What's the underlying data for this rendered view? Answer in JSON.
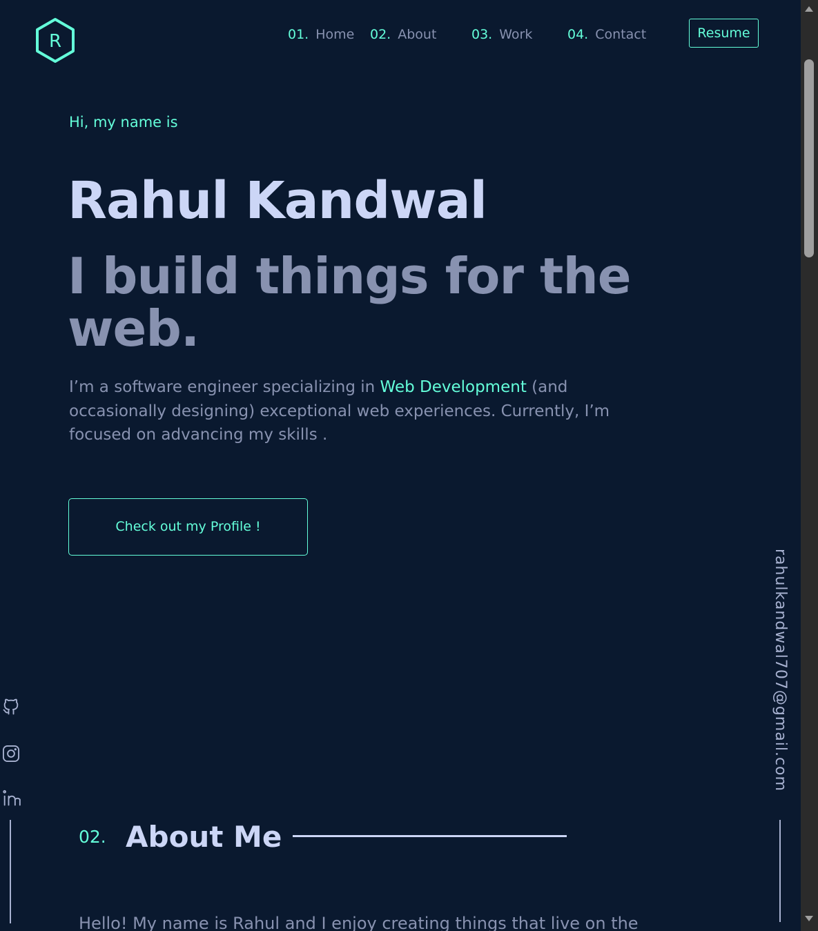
{
  "header": {
    "logo_letter": "R",
    "nav": [
      {
        "num": "01.",
        "label": "Home"
      },
      {
        "num": "02.",
        "label": "About"
      },
      {
        "num": "03.",
        "label": "Work"
      },
      {
        "num": "04.",
        "label": "Contact"
      }
    ],
    "resume_label": "Resume"
  },
  "hero": {
    "greeting": "Hi, my name is",
    "name": "Rahul Kandwal",
    "tagline": "I build things for the web.",
    "intro_before": "I’m a software engineer specializing in ",
    "intro_highlight": "Web Development",
    "intro_after": " (and occasionally designing) exceptional web experiences. Currently, I’m focused on advancing my skills .",
    "cta_label": "Check out my Profile !"
  },
  "social": {
    "icons": [
      "github-icon",
      "instagram-icon",
      "linkedin-icon"
    ]
  },
  "email": "rahulkandwal707@gmail.com",
  "about": {
    "num": "02.",
    "title": "About Me",
    "text": "Hello! My name is Rahul and I enjoy creating things that live on the"
  },
  "colors": {
    "background": "#0a192f",
    "accent": "#64ffda",
    "heading": "#ccd6f6",
    "body_text": "#8892b0"
  }
}
